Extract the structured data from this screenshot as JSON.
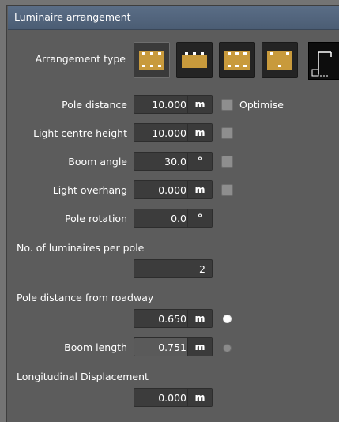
{
  "panel": {
    "title": "Luminaire arrangement"
  },
  "arrangement": {
    "label": "Arrangement type",
    "options": [
      "single-side-left",
      "single-side-right",
      "opposite",
      "staggered"
    ],
    "selected": "single-side-left",
    "extra_option": "pole-geometry"
  },
  "fields": {
    "pole_distance": {
      "label": "Pole distance",
      "value": "10.000",
      "unit": "m",
      "check_label": "Optimise"
    },
    "light_centre_height": {
      "label": "Light centre height",
      "value": "10.000",
      "unit": "m"
    },
    "boom_angle": {
      "label": "Boom angle",
      "value": "30.0",
      "unit": "°"
    },
    "light_overhang": {
      "label": "Light overhang",
      "value": "0.000",
      "unit": "m"
    },
    "pole_rotation": {
      "label": "Pole rotation",
      "value": "0.0",
      "unit": "°"
    },
    "luminaires_per_pole": {
      "label": "No. of luminaires per pole",
      "value": "2"
    },
    "pole_distance_roadway": {
      "label": "Pole distance from roadway",
      "value": "0.650",
      "unit": "m",
      "radio_selected": true
    },
    "boom_length": {
      "label": "Boom length",
      "value": "0.751",
      "unit": "m",
      "radio_selected": false
    },
    "longitudinal_displacement": {
      "label": "Longitudinal Displacement",
      "value": "0.000",
      "unit": "m"
    }
  },
  "colors": {
    "header": "#4f6179",
    "lamp_road": "#c89a3c",
    "panel_bg": "#5c5c5c"
  }
}
